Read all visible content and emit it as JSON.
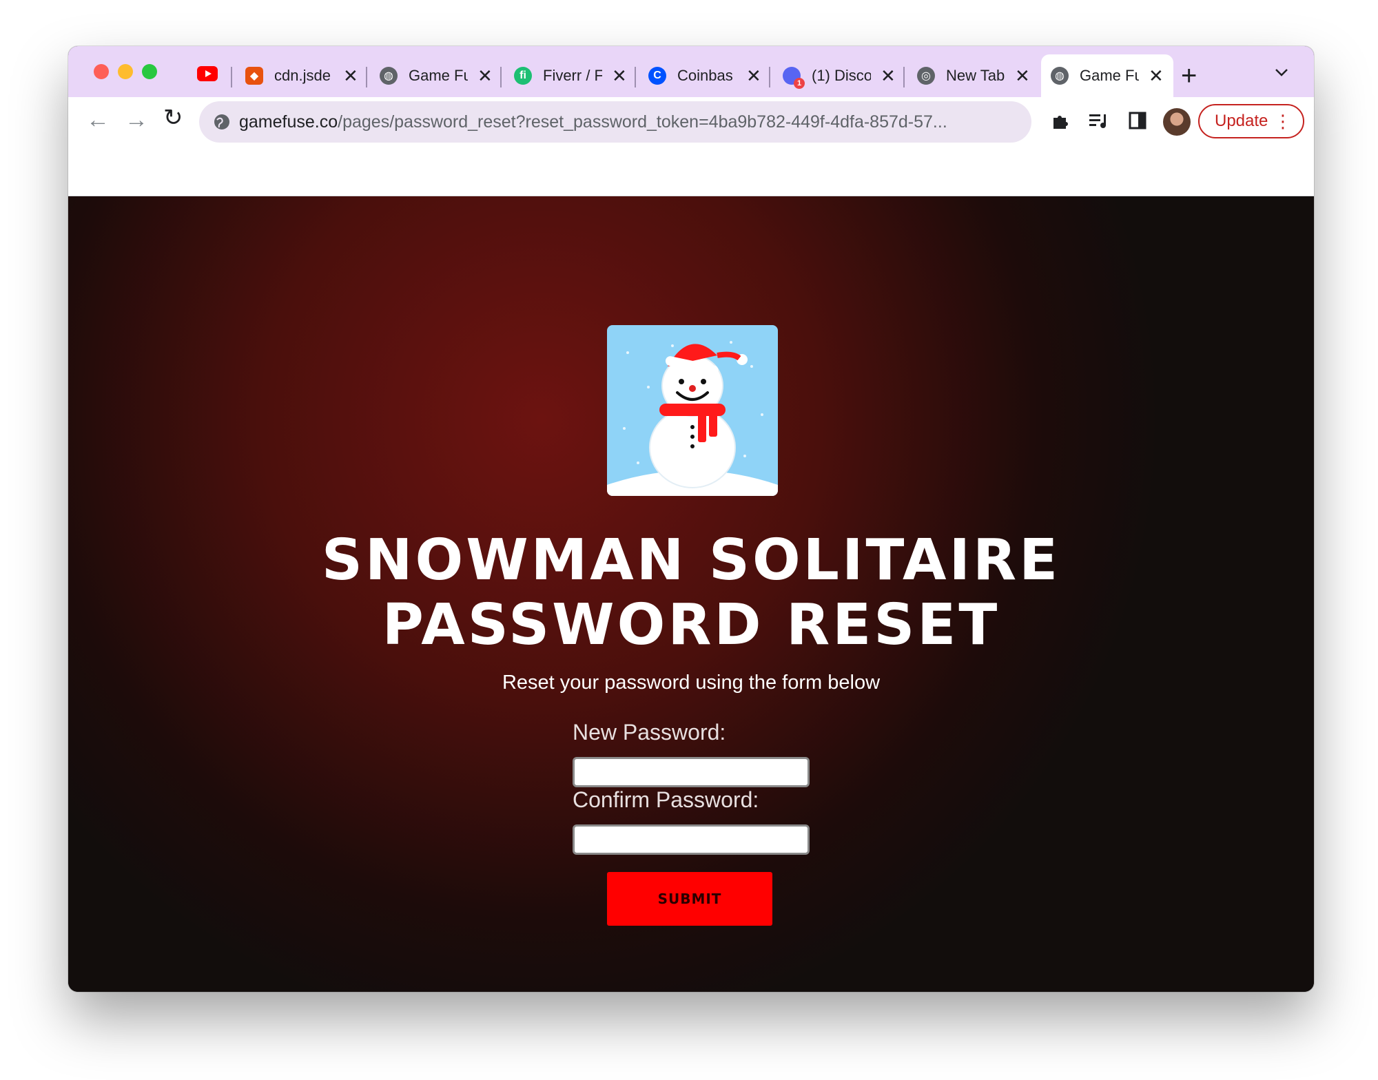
{
  "browser": {
    "tabs": [
      {
        "title": "",
        "favicon": "youtube-icon",
        "color": "#ff0000"
      },
      {
        "title": "cdn.jsde",
        "favicon": "brave-shield-icon",
        "color": "#e8520f"
      },
      {
        "title": "Game Fu",
        "favicon": "globe-icon",
        "color": "#5f6368"
      },
      {
        "title": "Fiverr / F",
        "favicon": "fiverr-icon",
        "color": "#1dbf73"
      },
      {
        "title": "Coinbas",
        "favicon": "coinbase-icon",
        "color": "#0052ff"
      },
      {
        "title": "(1) Disco",
        "favicon": "discord-icon",
        "color": "#5865f2"
      },
      {
        "title": "New Tab",
        "favicon": "chrome-icon",
        "color": "#5f6368"
      },
      {
        "title": "Game Fu",
        "favicon": "globe-icon",
        "color": "#5f6368"
      }
    ],
    "discord_badge": "1",
    "url_host": "gamefuse.co",
    "url_path": "/pages/password_reset?reset_password_token=4ba9b782-449f-4dfa-857d-57...",
    "update_label": "Update"
  },
  "page": {
    "title_line1": "SNOWMAN SOLITAIRE",
    "title_line2": "PASSWORD RESET",
    "subtitle": "Reset your password using the form below",
    "new_password_label": "New Password:",
    "confirm_password_label": "Confirm Password:",
    "new_password_value": "",
    "confirm_password_value": "",
    "submit_label": "SUBMIT"
  },
  "colors": {
    "tabstrip": "#e9d6f8",
    "submit": "#ff0000",
    "background_center": "#6c1310",
    "background_edge": "#120d0c"
  }
}
